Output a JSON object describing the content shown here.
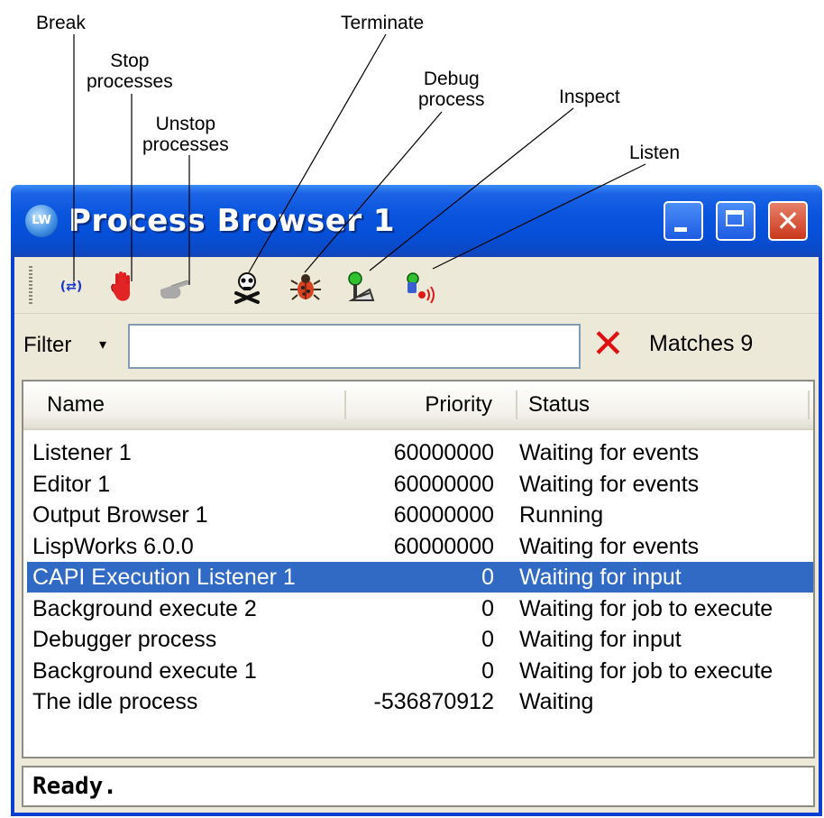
{
  "callouts": {
    "break": "Break",
    "stop": "Stop\nprocesses",
    "unstop": "Unstop\nprocesses",
    "terminate": "Terminate",
    "debug": "Debug\nprocess",
    "inspect": "Inspect",
    "listen": "Listen"
  },
  "window": {
    "title": "Process Browser 1",
    "app_icon": "LW",
    "close_glyph": "✕"
  },
  "toolbar": {
    "break_glyph": "(⇄)",
    "icons": [
      "break-icon",
      "stop-hand-icon",
      "unstop-hand-icon",
      "skull-crossbones-icon",
      "bug-icon",
      "inspect-icon",
      "listen-icon"
    ]
  },
  "filter": {
    "label": "Filter",
    "arrow": "▾",
    "value": "",
    "matches": "Matches 9"
  },
  "list": {
    "columns": {
      "name": "Name",
      "priority": "Priority",
      "status": "Status"
    },
    "rows": [
      {
        "name": "Listener 1",
        "priority": "60000000",
        "status": "Waiting for events",
        "selected": false
      },
      {
        "name": "Editor 1",
        "priority": "60000000",
        "status": "Waiting for events",
        "selected": false
      },
      {
        "name": "Output Browser 1",
        "priority": "60000000",
        "status": "Running",
        "selected": false
      },
      {
        "name": "LispWorks 6.0.0",
        "priority": "60000000",
        "status": "Waiting for events",
        "selected": false
      },
      {
        "name": "CAPI Execution Listener 1",
        "priority": "0",
        "status": "Waiting for input",
        "selected": true
      },
      {
        "name": "Background execute 2",
        "priority": "0",
        "status": "Waiting for job to execute",
        "selected": false
      },
      {
        "name": "Debugger process",
        "priority": "0",
        "status": "Waiting for input",
        "selected": false
      },
      {
        "name": "Background execute 1",
        "priority": "0",
        "status": "Waiting for job to execute",
        "selected": false
      },
      {
        "name": "The idle process",
        "priority": "-536870912",
        "status": "Waiting",
        "selected": false
      }
    ]
  },
  "status_bar": {
    "text": "Ready."
  },
  "colors": {
    "titlebar": "#0a55de",
    "selection": "#316ac5",
    "window_bg": "#ece9d8",
    "clear_x": "#e01010"
  }
}
